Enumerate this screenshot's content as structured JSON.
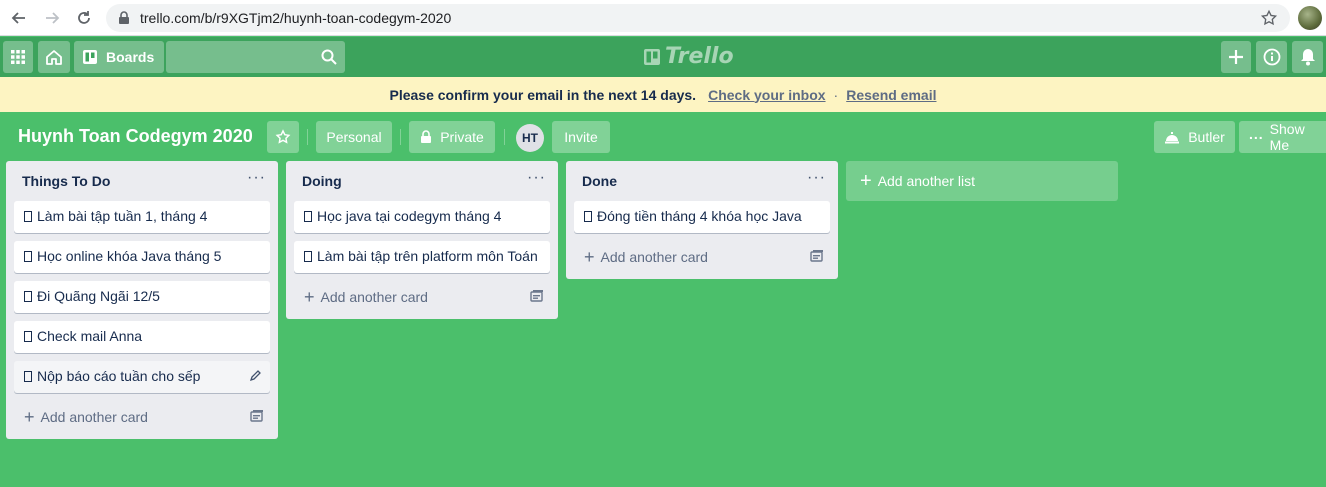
{
  "browser": {
    "url": "trello.com/b/r9XGTjm2/huynh-toan-codegym-2020"
  },
  "header": {
    "boards_label": "Boards",
    "logo_text": "Trello"
  },
  "banner": {
    "message": "Please confirm your email in the next 14 days.",
    "check_inbox": "Check your inbox",
    "separator": "·",
    "resend": "Resend email"
  },
  "board": {
    "title": "Huynh Toan Codegym 2020",
    "team_label": "Personal",
    "visibility_label": "Private",
    "avatar_initials": "HT",
    "invite_label": "Invite",
    "butler_label": "Butler",
    "show_menu_label": "Show Me"
  },
  "lists": [
    {
      "title": "Things To Do",
      "cards": [
        "Làm bài tập tuần 1, tháng 4",
        "Học online khóa Java tháng 5",
        "Đi Quãng Ngãi 12/5",
        "Check mail Anna",
        "Nộp báo cáo tuần cho sếp"
      ],
      "add_card_label": "Add another card"
    },
    {
      "title": "Doing",
      "cards": [
        "Học java tại codegym tháng 4",
        "Làm bài tập trên platform môn Toán"
      ],
      "add_card_label": "Add another card"
    },
    {
      "title": "Done",
      "cards": [
        "Đóng tiền tháng 4 khóa học Java"
      ],
      "add_card_label": "Add another card"
    }
  ],
  "add_list_label": "Add another list",
  "colors": {
    "board_bg": "#4bbf6b",
    "header_bg": "#3ca35c",
    "banner_bg": "#fdf4c2",
    "list_bg": "#ebecf0"
  }
}
